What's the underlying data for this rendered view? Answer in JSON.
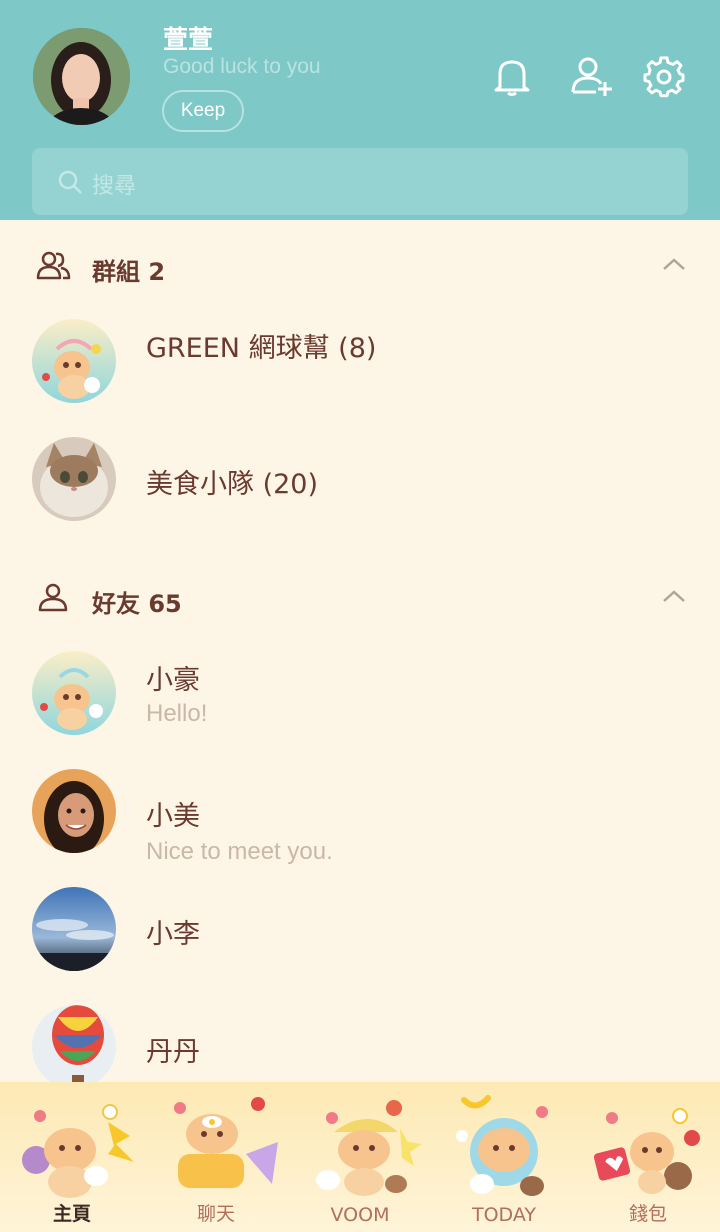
{
  "profile": {
    "name": "萱萱",
    "status": "Good luck to you",
    "keep_label": "Keep"
  },
  "header_icons": [
    "bell-icon",
    "add-friend-icon",
    "gear-icon"
  ],
  "search": {
    "placeholder": "搜尋"
  },
  "groups": {
    "title": "群組 2",
    "items": [
      {
        "name": "GREEN 網球幫 (8)"
      },
      {
        "name": "美食小隊 (20)"
      }
    ]
  },
  "friends": {
    "title": "好友 65",
    "items": [
      {
        "name": "小豪",
        "status": "Hello!"
      },
      {
        "name": "小美",
        "status": "Nice to meet you."
      },
      {
        "name": "小李"
      },
      {
        "name": "丹丹"
      }
    ]
  },
  "nav": [
    {
      "label": "主頁",
      "active": true
    },
    {
      "label": "聊天"
    },
    {
      "label": "VOOM"
    },
    {
      "label": "TODAY"
    },
    {
      "label": "錢包"
    }
  ],
  "colors": {
    "header": "#7ec8c8",
    "background": "#fdf6e6",
    "text_primary": "#6a3a2e",
    "text_secondary": "#c9b7aa"
  }
}
